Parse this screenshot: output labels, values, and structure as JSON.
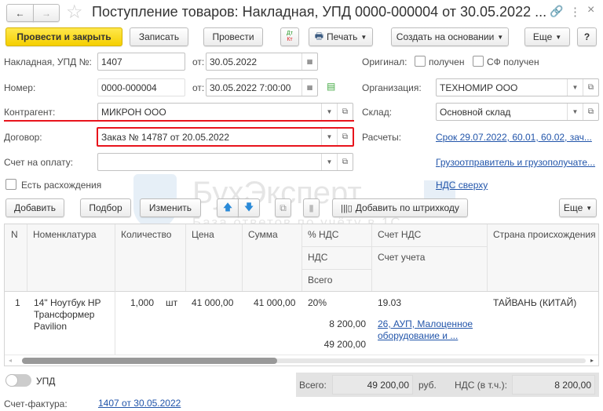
{
  "window": {
    "title": "Поступление товаров: Накладная, УПД 0000-000004 от 30.05.2022 ...",
    "close": "×",
    "more": "⋮"
  },
  "toolbar": {
    "post_close": "Провести и закрыть",
    "save": "Записать",
    "post": "Провести",
    "dt": "Дт",
    "kt": "Кт",
    "print": "Печать",
    "create_based": "Создать на основании",
    "more": "Еще",
    "help": "?"
  },
  "form": {
    "invoice_label": "Накладная, УПД №:",
    "invoice_no": "1407",
    "from_label": "от:",
    "invoice_date": "30.05.2022",
    "number_label": "Номер:",
    "number": "0000-000004",
    "number_date": "30.05.2022  7:00:00",
    "original_label": "Оригинал:",
    "received": "получен",
    "sf_received": "СФ получен",
    "org_label": "Организация:",
    "org": "ТЕХНОМИР ООО",
    "counterparty_label": "Контрагент:",
    "counterparty": "МИКРОН ООО",
    "warehouse_label": "Склад:",
    "warehouse": "Основной склад",
    "contract_label": "Договор:",
    "contract": "Заказ № 14787 от 20.05.2022",
    "settlements_label": "Расчеты:",
    "settlements": "Срок 29.07.2022, 60.01, 60.02, зач...",
    "payment_invoice_label": "Счет на оплату:",
    "payment_invoice": "",
    "shipper_link": "Грузоотправитель и грузополучате...",
    "discrepancies": "Есть расхождения",
    "vat_link": "НДС сверху"
  },
  "table_toolbar": {
    "add": "Добавить",
    "pick": "Подбор",
    "edit": "Изменить",
    "barcode": "Добавить по штрихкоду",
    "more": "Еще"
  },
  "table": {
    "headers": {
      "n": "N",
      "item": "Номенклатура",
      "qty": "Количество",
      "price": "Цена",
      "sum": "Сумма",
      "vat_rate": "% НДС",
      "vat": "НДС",
      "total": "Всего",
      "vat_account": "Счет НДС",
      "account": "Счет учета",
      "country": "Страна происхождения"
    },
    "rows": [
      {
        "n": "1",
        "item": "14\" Ноутбук HP Трансформер Pavilion",
        "qty": "1,000",
        "unit": "шт",
        "price": "41 000,00",
        "sum": "41 000,00",
        "vat_rate": "20%",
        "vat": "8 200,00",
        "total": "49 200,00",
        "vat_account": "19.03",
        "account": "26, АУП, Малоценное оборудование и ...",
        "country": "ТАЙВАНЬ (КИТАЙ)"
      }
    ]
  },
  "footer": {
    "upd": "УПД",
    "total_label": "Всего:",
    "total": "49 200,00",
    "currency": "руб.",
    "vat_label": "НДС (в т.ч.):",
    "vat": "8 200,00",
    "sf_label": "Счет-фактура:",
    "sf_link": "1407 от 30.05.2022"
  },
  "watermark": {
    "brand": "БухЭксперт8",
    "tagline": "База ответов по учёту в 1С"
  }
}
